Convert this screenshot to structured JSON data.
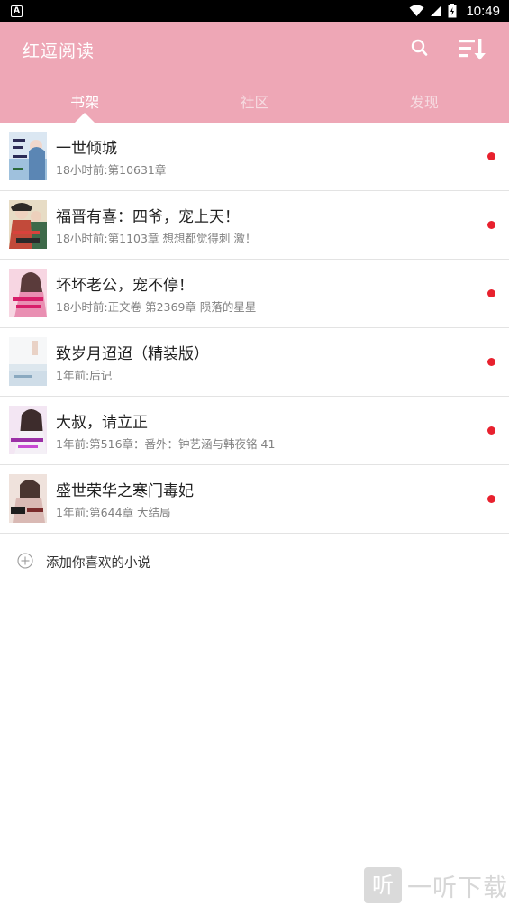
{
  "status_bar": {
    "time": "10:49",
    "left_icon": "A",
    "icons": [
      "wifi-icon",
      "signal-icon",
      "battery-icon"
    ]
  },
  "header": {
    "title": "红逗阅读",
    "search_icon": "search-icon",
    "sort_icon": "sort-icon",
    "background_color": "#eea7b6"
  },
  "tabs": [
    {
      "label": "书架",
      "active": true
    },
    {
      "label": "社区",
      "active": false
    },
    {
      "label": "发现",
      "active": false
    }
  ],
  "books": [
    {
      "title": "一世倾城",
      "subtitle": "18小时前:第10631章",
      "unread": true
    },
    {
      "title": "福晋有喜：四爷，宠上天！",
      "subtitle": "18小时前:第1103章 想想都觉得刺 激！",
      "unread": true
    },
    {
      "title": "坏坏老公，宠不停！",
      "subtitle": "18小时前:正文卷 第2369章 陨落的星星",
      "unread": true
    },
    {
      "title": "致岁月迢迢（精装版）",
      "subtitle": "1年前:后记",
      "unread": true
    },
    {
      "title": "大叔，请立正",
      "subtitle": "1年前:第516章：番外：钟艺涵与韩夜铭 41",
      "unread": true
    },
    {
      "title": "盛世荣华之寒门毒妃",
      "subtitle": "1年前:第644章 大结局",
      "unread": true
    }
  ],
  "add_book": {
    "label": "添加你喜欢的小说"
  },
  "watermark": {
    "glyph": "听",
    "text": "一听下载"
  },
  "colors": {
    "accent": "#eea7b6",
    "unread_dot": "#e8212e"
  }
}
